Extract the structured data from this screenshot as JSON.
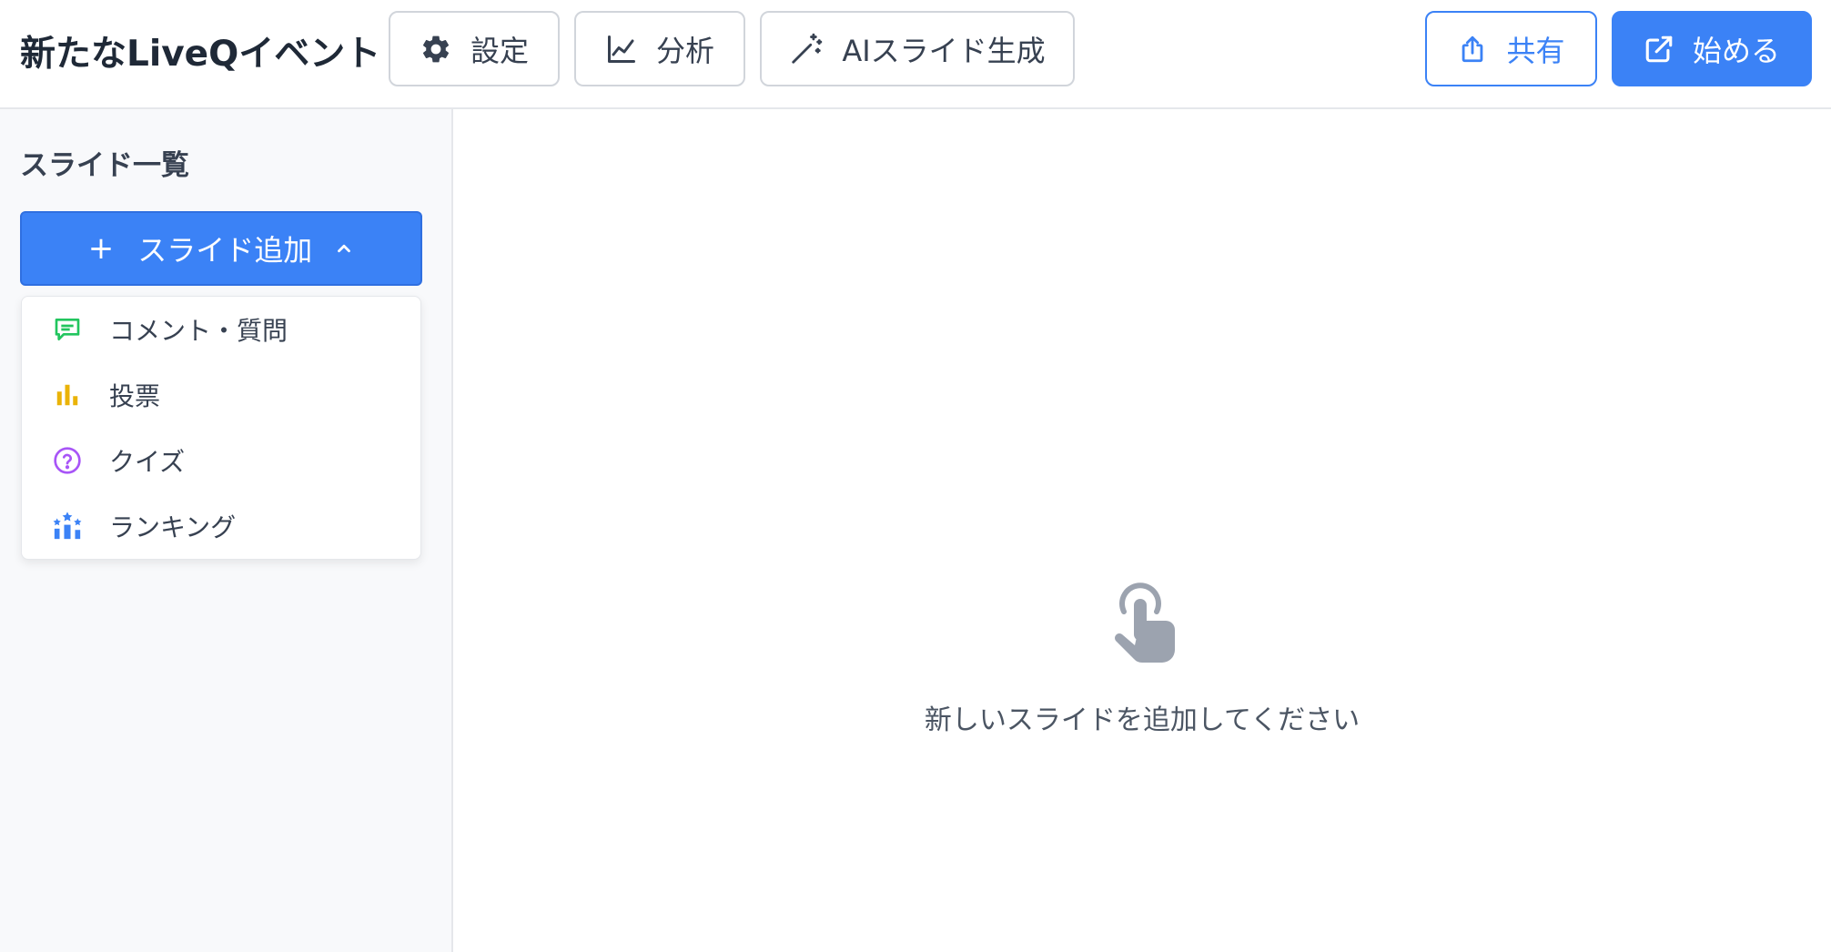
{
  "header": {
    "title": "新たなLiveQイベント",
    "buttons": {
      "settings": "設定",
      "analysis": "分析",
      "ai_slides": "AIスライド生成",
      "share": "共有",
      "start": "始める"
    }
  },
  "sidebar": {
    "title": "スライド一覧",
    "add_slide_label": "スライド追加",
    "menu_items": [
      {
        "label": "コメント・質問",
        "icon": "comment-icon",
        "color": "#22c55e"
      },
      {
        "label": "投票",
        "icon": "bar-chart-icon",
        "color": "#eab308"
      },
      {
        "label": "クイズ",
        "icon": "question-circle-icon",
        "color": "#a855f7"
      },
      {
        "label": "ランキング",
        "icon": "ranking-icon",
        "color": "#3b82f6"
      }
    ]
  },
  "main": {
    "empty_message": "新しいスライドを追加してください",
    "empty_icon": "pointer-hand-icon"
  },
  "colors": {
    "accent": "#3b82f6",
    "sidebar_bg": "#f8f9fb",
    "border": "#e5e7eb"
  }
}
